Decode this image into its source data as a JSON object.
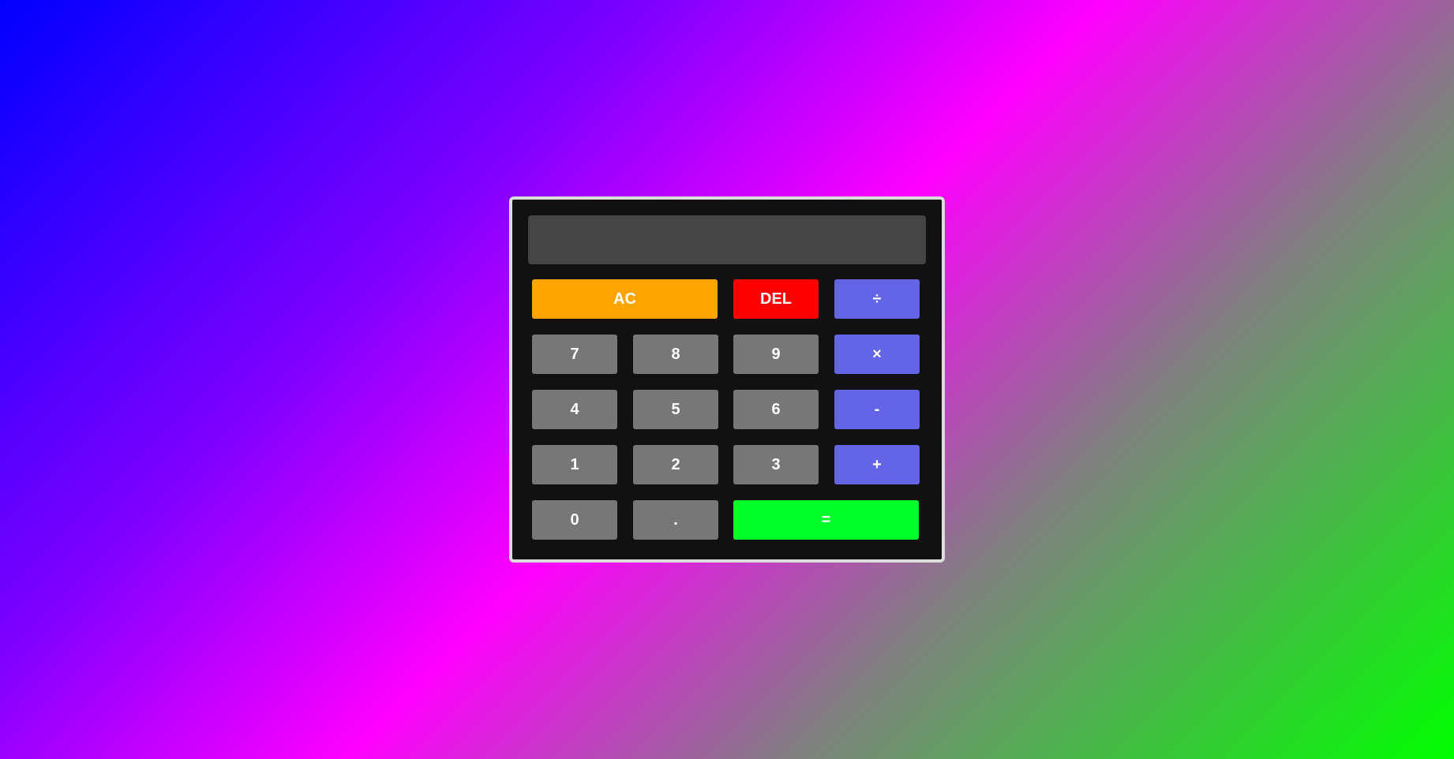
{
  "display": {
    "value": ""
  },
  "buttons": {
    "ac": "AC",
    "del": "DEL",
    "divide": "÷",
    "seven": "7",
    "eight": "8",
    "nine": "9",
    "multiply": "×",
    "four": "4",
    "five": "5",
    "six": "6",
    "subtract": "-",
    "one": "1",
    "two": "2",
    "three": "3",
    "add": "+",
    "zero": "0",
    "decimal": ".",
    "equals": "="
  },
  "colors": {
    "number_key": "#777777",
    "operator_key": "#6464e6",
    "clear_key": "#ffa500",
    "delete_key": "#ff0000",
    "equals_key": "#00ff2a",
    "calculator_body": "#111111",
    "display_background": "#454545"
  }
}
